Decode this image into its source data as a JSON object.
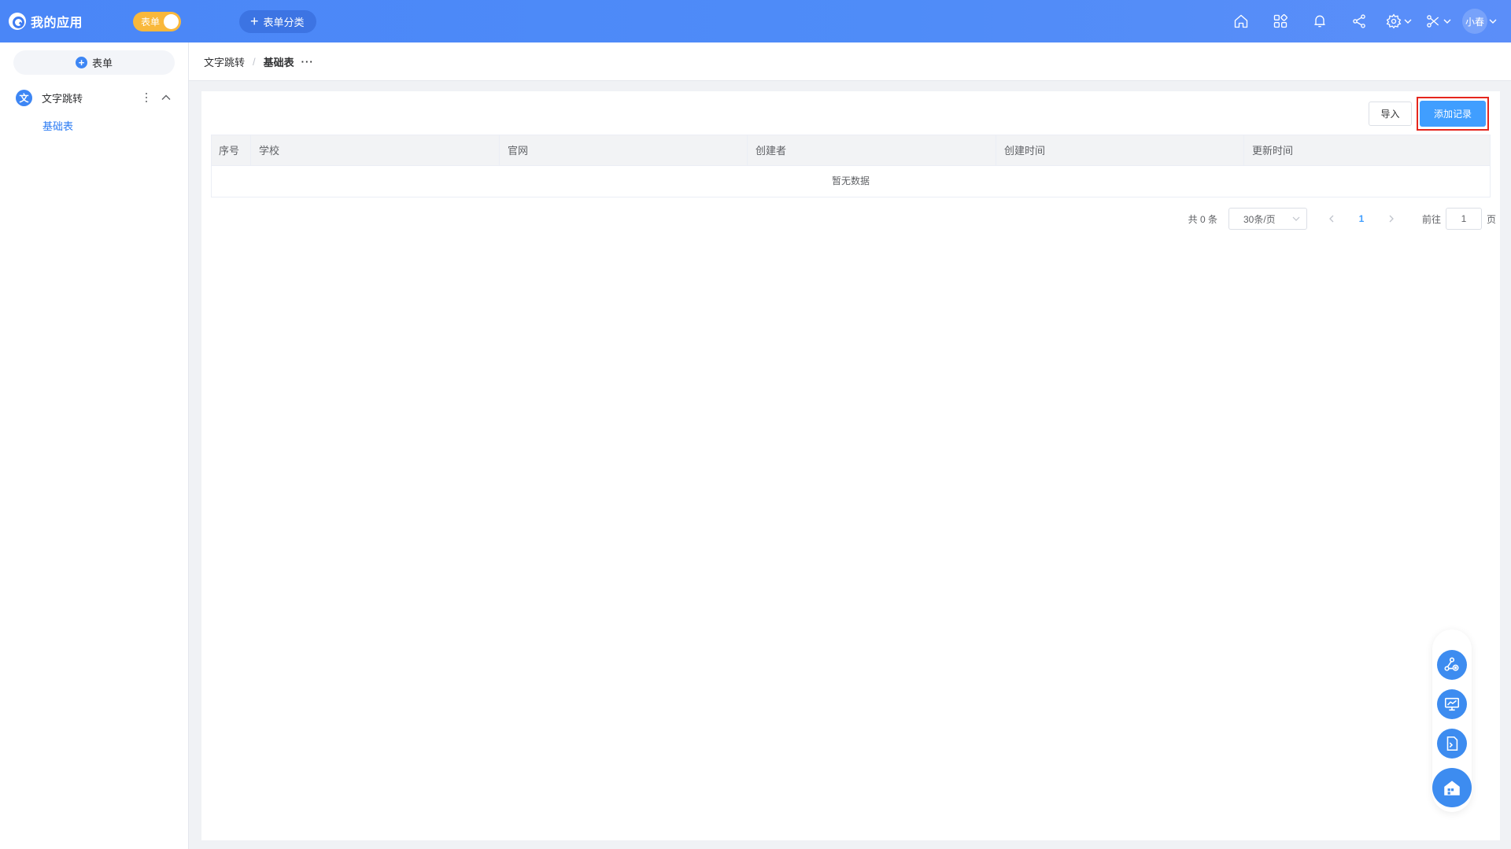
{
  "app": {
    "title": "我的应用",
    "mode_toggle_label": "表单",
    "category_button_label": "表单分类",
    "user_name": "小春",
    "colors": {
      "brand": "#4a86f7",
      "toggle": "#f9b83b",
      "primary": "#409eff",
      "highlight_border": "#e5261d"
    }
  },
  "topbar_icons": [
    "home-icon",
    "apps-grid-icon",
    "bell-icon",
    "share-icon",
    "gear-icon",
    "tools-icon"
  ],
  "sidebar": {
    "add_button_label": "表单",
    "group": {
      "icon_text": "文",
      "label": "文字跳转"
    },
    "items": [
      {
        "label": "基础表"
      }
    ]
  },
  "breadcrumb": {
    "parent": "文字跳转",
    "separator": "/",
    "current": "基础表",
    "more": "···"
  },
  "toolbar": {
    "import_label": "导入",
    "add_record_label": "添加记录"
  },
  "table": {
    "columns": [
      "序号",
      "学校",
      "官网",
      "创建者",
      "创建时间",
      "更新时间"
    ],
    "empty_text": "暂无数据"
  },
  "pagination": {
    "total_text": "共 0 条",
    "page_size": "30条/页",
    "current_page": "1",
    "goto_prefix": "前往",
    "goto_value": "1",
    "goto_suffix": "页"
  },
  "floating_toolbar": [
    "workflow-icon",
    "dashboard-icon",
    "script-icon",
    "home-portal-icon"
  ]
}
